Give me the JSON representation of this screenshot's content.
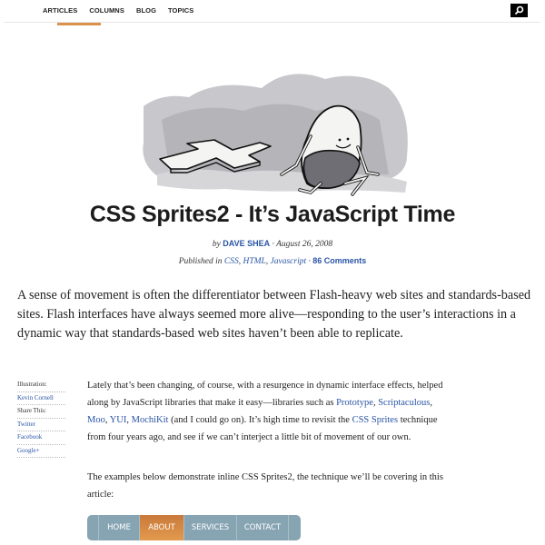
{
  "topnav": {
    "items": [
      "ARTICLES",
      "COLUMNS",
      "BLOG",
      "TOPICS"
    ],
    "active_index": 0,
    "accent_color": "#d9924a",
    "search_icon": "search-icon"
  },
  "hero": {
    "alt": "Illustration of a cartoon egg character sitting beside a fallen plus-sign shape"
  },
  "article": {
    "title": "CSS Sprites2 - It’s JavaScript Time",
    "byline_prefix": "by",
    "author": "DAVE SHEA",
    "date": "· August 26, 2008",
    "published_prefix": "Published in",
    "categories": [
      "CSS",
      "HTML",
      "Javascript"
    ],
    "comments": "86 Comments",
    "intro": "A sense of movement is often the differentiator between Flash-heavy web sites and standards-based sites. Flash interfaces have always seemed more alive—responding to the user’s interactions in a dynamic way that standards-based web sites haven’t been able to replicate.",
    "p1": {
      "t1": "Lately that’s been changing, of course, with a resurgence in dynamic interface effects, helped along by JavaScript libraries that make it easy—libraries such as ",
      "l1": "Prototype",
      "t2": ", ",
      "l2": "Scriptaculous",
      "t3": ", ",
      "l3": "Moo",
      "t4": ", ",
      "l4": "YUI",
      "t5": ", ",
      "l5": "MochiKit",
      "t6": " (and I could go on). It’s high time to revisit the ",
      "l6": "CSS Sprites",
      "t7": " technique from four years ago, and see if we can’t interject a little bit of movement of our own."
    },
    "p2": "The examples below demonstrate inline CSS Sprites2, the technique we’ll be covering in this article:"
  },
  "aside": {
    "illustration_label": "Illustration:",
    "illustrator": "Kevin Cornell",
    "share_label": "Share This:",
    "share_links": [
      "Twitter",
      "Facebook",
      "Google+"
    ]
  },
  "demo_nav": {
    "items": [
      "HOME",
      "ABOUT",
      "SERVICES",
      "CONTACT"
    ],
    "active": "ABOUT",
    "bg_color": "#87a4b3",
    "active_color": "#d98a45"
  },
  "colors": {
    "link": "#2a55a6",
    "text": "#222222"
  }
}
